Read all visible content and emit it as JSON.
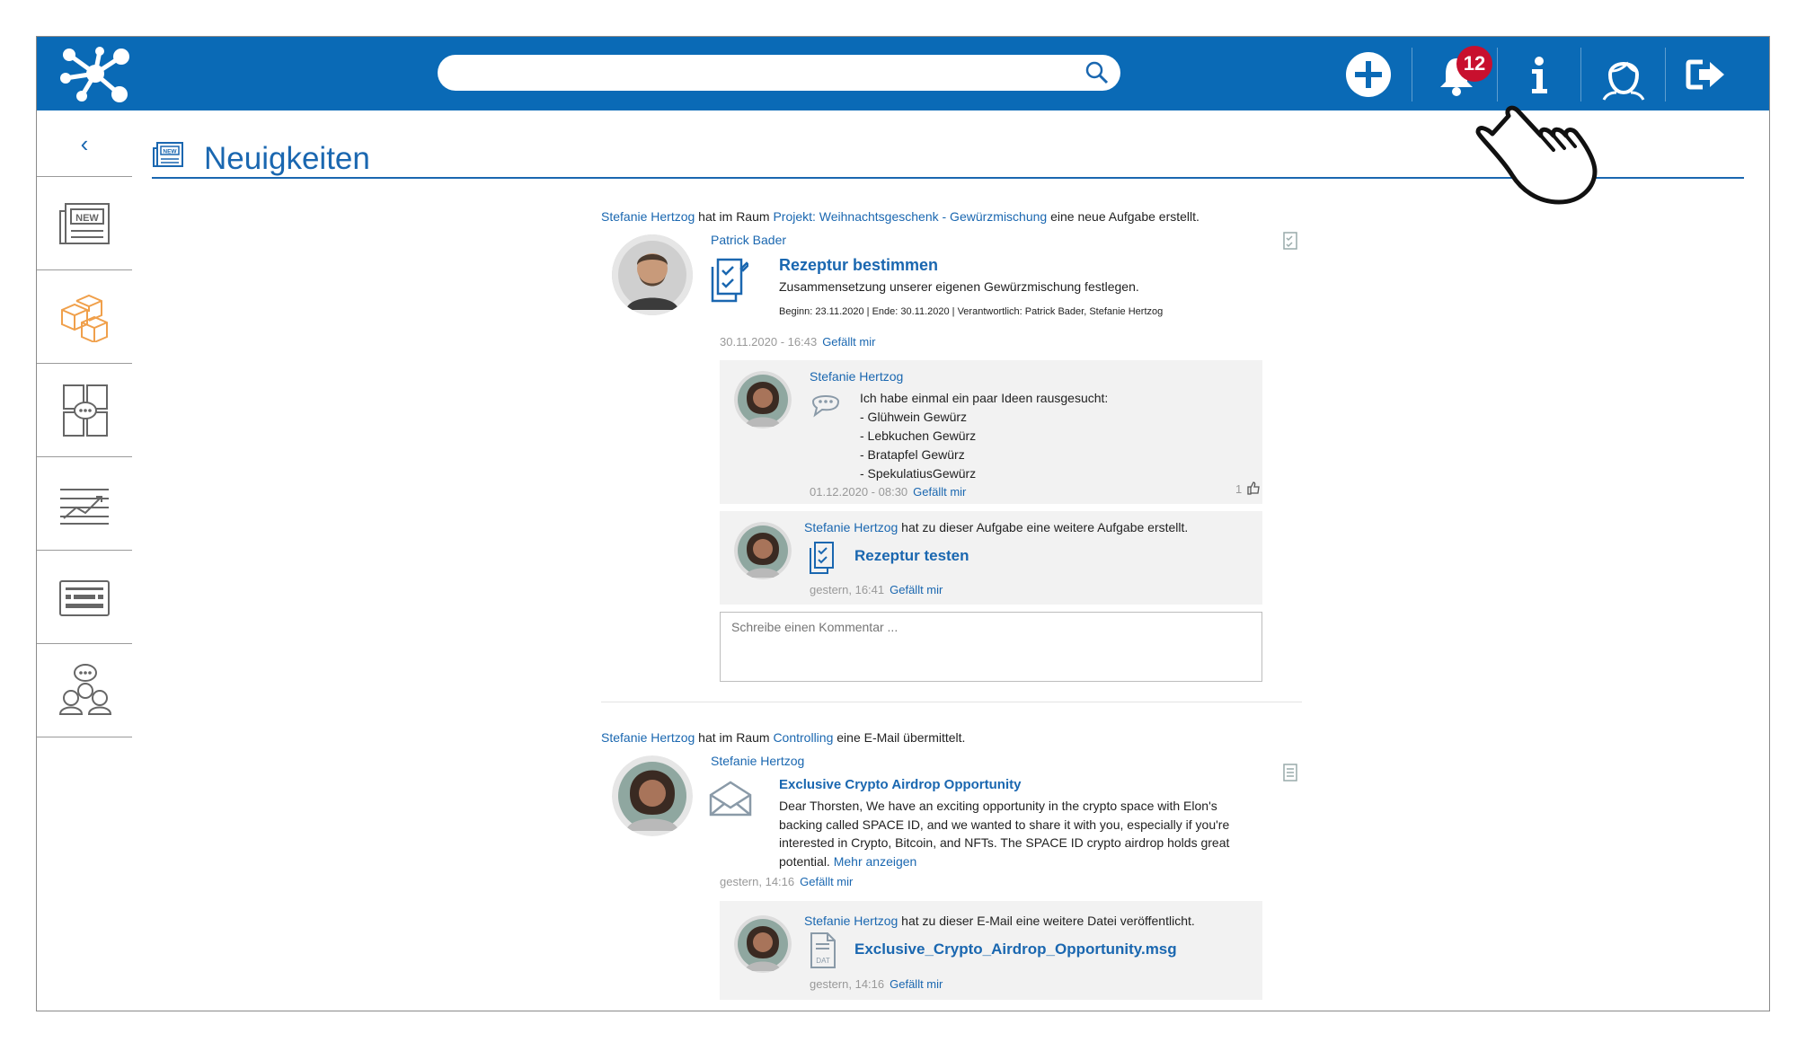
{
  "search": {
    "placeholder": ""
  },
  "notifications": {
    "count": "12"
  },
  "page": {
    "title": "Neuigkeiten"
  },
  "sidebar": {
    "collapse": "‹",
    "items": [
      {
        "icon": "news-icon",
        "active": false
      },
      {
        "icon": "rooms-icon",
        "active": true
      },
      {
        "icon": "chat-icon",
        "active": false
      },
      {
        "icon": "dashboard-icon",
        "active": false
      },
      {
        "icon": "keyboard-icon",
        "active": false
      },
      {
        "icon": "community-icon",
        "active": false
      }
    ]
  },
  "feed": [
    {
      "actor": "Stefanie Hertzog",
      "text1": " hat im Raum ",
      "room": "Projekt: Weihnachtsgeschenk - Gewürzmischung",
      "text2": " eine neue Aufgabe erstellt.",
      "author": "Patrick Bader",
      "title": "Rezeptur bestimmen",
      "description": "Zusammensetzung unserer eigenen Gewürzmischung festlegen.",
      "meta": "Beginn: 23.11.2020 | Ende: 30.11.2020 | Verantwortlich: Patrick Bader, Stefanie Hertzog",
      "timestamp": "30.11.2020 - 16:43",
      "like": "Gefällt mir",
      "comment": {
        "author": "Stefanie Hertzog",
        "lines": [
          "Ich habe einmal ein paar Ideen rausgesucht:",
          "- Glühwein Gewürz",
          "- Lebkuchen Gewürz",
          "- Bratapfel Gewürz",
          "- SpekulatiusGewürz"
        ],
        "timestamp": "01.12.2020 - 08:30",
        "like": "Gefällt mir",
        "like_count": "1"
      },
      "sub": {
        "actor": "Stefanie Hertzog",
        "text": " hat zu dieser Aufgabe eine weitere Aufgabe erstellt.",
        "title": "Rezeptur testen",
        "timestamp": "gestern, 16:41",
        "like": "Gefällt mir"
      },
      "comment_placeholder": "Schreibe einen Kommentar ..."
    },
    {
      "actor": "Stefanie Hertzog",
      "text1": " hat im Raum ",
      "room": "Controlling",
      "text2": " eine E-Mail übermittelt.",
      "author": "Stefanie Hertzog",
      "title": "Exclusive Crypto Airdrop Opportunity",
      "body": [
        "Dear Thorsten, We have an exciting opportunity in the crypto space with Elon's",
        "backing called SPACE ID, and we wanted to share it with you, especially if you're",
        "interested in Crypto, Bitcoin, and NFTs. The SPACE ID crypto airdrop holds great"
      ],
      "body_last": "potential. ",
      "more": "Mehr anzeigen",
      "timestamp": "gestern, 14:16",
      "like": "Gefällt mir",
      "sub": {
        "actor": "Stefanie Hertzog",
        "text": " hat zu dieser E-Mail eine weitere Datei veröffentlicht.",
        "title": "Exclusive_Crypto_Airdrop_Opportunity.msg",
        "timestamp": "gestern, 14:16",
        "like": "Gefällt mir"
      }
    }
  ],
  "colors": {
    "brand": "#0a6ab6",
    "link": "#1a67b0",
    "active": "#f0a04b",
    "badge": "#c8102e"
  }
}
